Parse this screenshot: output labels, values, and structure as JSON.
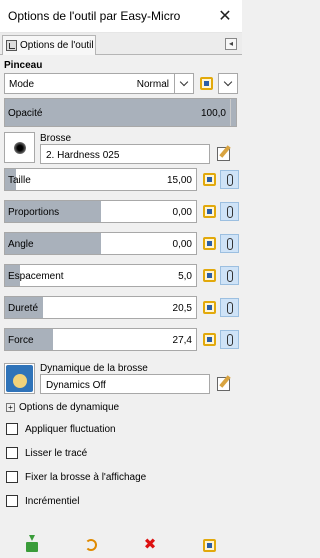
{
  "window": {
    "title": "Options de l'outil par Easy-Micro",
    "close_glyph": "✕"
  },
  "tab": {
    "label": "Options de l'outil",
    "menu_glyph": "◂"
  },
  "section": {
    "heading": "Pinceau"
  },
  "mode": {
    "label": "Mode",
    "value": "Normal"
  },
  "opacity": {
    "label": "Opacité",
    "value": "100,0",
    "fraction": 1.0
  },
  "brush": {
    "label": "Brosse",
    "name": "2. Hardness 025"
  },
  "sliders": [
    {
      "label": "Taille",
      "value": "15,00",
      "fraction": 0.06
    },
    {
      "label": "Proportions",
      "value": "0,00",
      "fraction": 0.5
    },
    {
      "label": "Angle",
      "value": "0,00",
      "fraction": 0.5
    },
    {
      "label": "Espacement",
      "value": "5,0",
      "fraction": 0.08
    },
    {
      "label": "Dureté",
      "value": "20,5",
      "fraction": 0.2
    },
    {
      "label": "Force",
      "value": "27,4",
      "fraction": 0.25
    }
  ],
  "dynamics": {
    "label": "Dynamique de la brosse",
    "name": "Dynamics Off",
    "options_label": "Options de dynamique",
    "expander_glyph": "+"
  },
  "checkboxes": [
    {
      "label": "Appliquer fluctuation",
      "checked": false
    },
    {
      "label": "Lisser le tracé",
      "checked": false
    },
    {
      "label": "Fixer la brosse à l'affichage",
      "checked": false
    },
    {
      "label": "Incrémentiel",
      "checked": false
    }
  ],
  "bottom_bar": {
    "delete_glyph": "✖"
  },
  "colors": {
    "slider_fill": "#a9b1bb",
    "chain_button_bg": "#cfe3f7",
    "reset_icon": "#e2a90b",
    "save_icon": "#3a9c3a",
    "restore_icon": "#e08a00",
    "delete_icon": "#dd1111"
  }
}
